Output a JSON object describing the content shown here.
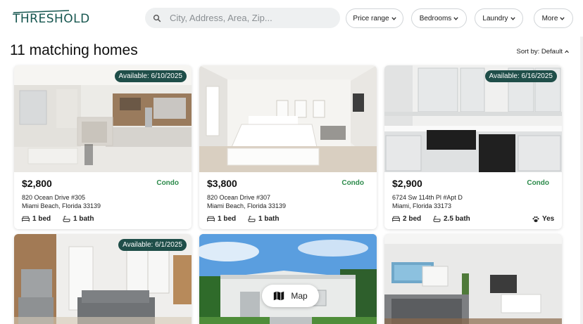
{
  "header": {
    "logo_text": "THRESHOLD",
    "search_placeholder": "City, Address, Area, Zip...",
    "filters": [
      {
        "label": "Price range"
      },
      {
        "label": "Bedrooms"
      },
      {
        "label": "Laundry"
      },
      {
        "label": "More"
      }
    ]
  },
  "results": {
    "title": "11 matching homes",
    "sort_label": "Sort by: Default"
  },
  "listings": [
    {
      "available": "Available: 6/10/2025",
      "price": "$2,800",
      "type": "Condo",
      "address_line1": "820 Ocean Drive #305",
      "address_line2": "Miami Beach, Florida 33139",
      "beds": "1 bed",
      "baths": "1 bath",
      "pets": ""
    },
    {
      "available": "",
      "price": "$3,800",
      "type": "Condo",
      "address_line1": "820 Ocean Drive #307",
      "address_line2": "Miami Beach, Florida 33139",
      "beds": "1 bed",
      "baths": "1 bath",
      "pets": ""
    },
    {
      "available": "Available: 6/16/2025",
      "price": "$2,900",
      "type": "Condo",
      "address_line1": "6724 Sw 114th Pl #Apt D",
      "address_line2": "Miami, Florida 33173",
      "beds": "2 bed",
      "baths": "2.5 bath",
      "pets": "Yes"
    },
    {
      "available": "Available: 6/1/2025"
    },
    {
      "available": ""
    },
    {
      "available": ""
    }
  ],
  "map_button": {
    "label": "Map"
  },
  "colors": {
    "brand": "#1f4e49",
    "condo": "#2b8a4a"
  },
  "icons": [
    "search-icon",
    "chevron-down-icon",
    "chevron-up-icon",
    "bed-icon",
    "bath-icon",
    "paw-icon",
    "map-icon"
  ]
}
